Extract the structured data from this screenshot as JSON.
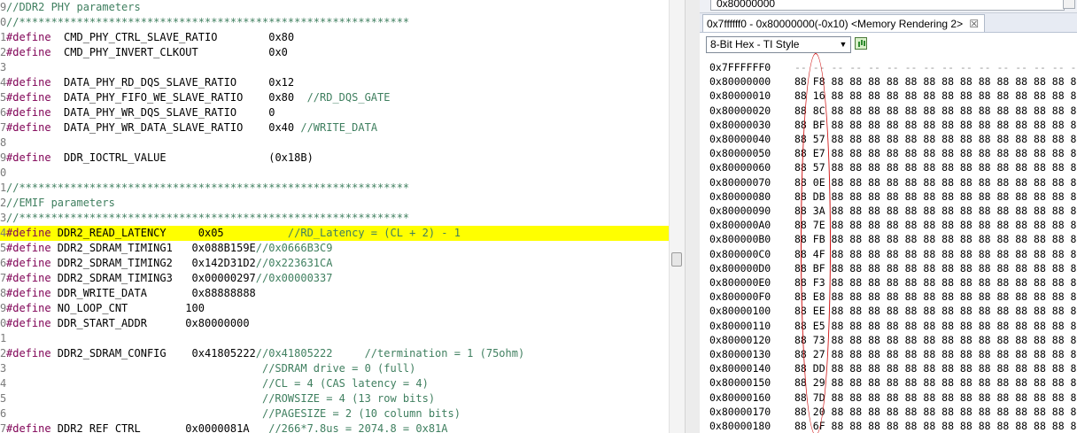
{
  "editor": {
    "line_number_digits": [
      "9",
      "0",
      "1",
      "2",
      "3",
      "4",
      "5",
      "6",
      "7",
      "8",
      "9",
      "0",
      "1",
      "2",
      "3",
      "4",
      "5",
      "6",
      "7",
      "8",
      "9",
      "0",
      "1",
      "2",
      "3",
      "4",
      "5",
      "6",
      "7"
    ],
    "lines": [
      {
        "parts": [
          {
            "t": "//DDR2 PHY parameters",
            "c": "cm"
          }
        ]
      },
      {
        "parts": [
          {
            "t": "//*************************************************************",
            "c": "cm"
          }
        ]
      },
      {
        "parts": [
          {
            "t": "#define",
            "c": "kw"
          },
          {
            "t": "  CMD_PHY_CTRL_SLAVE_RATIO        0x80",
            "c": "nm"
          }
        ]
      },
      {
        "parts": [
          {
            "t": "#define",
            "c": "kw"
          },
          {
            "t": "  CMD_PHY_INVERT_CLKOUT           0x0",
            "c": "nm"
          }
        ]
      },
      {
        "parts": []
      },
      {
        "parts": [
          {
            "t": "#define",
            "c": "kw"
          },
          {
            "t": "  DATA_PHY_RD_DQS_SLAVE_RATIO     0x12",
            "c": "nm"
          }
        ]
      },
      {
        "parts": [
          {
            "t": "#define",
            "c": "kw"
          },
          {
            "t": "  DATA_PHY_FIFO_WE_SLAVE_RATIO    0x80  ",
            "c": "nm"
          },
          {
            "t": "//RD_DQS_GATE",
            "c": "cm"
          }
        ]
      },
      {
        "parts": [
          {
            "t": "#define",
            "c": "kw"
          },
          {
            "t": "  DATA_PHY_WR_DQS_SLAVE_RATIO     0",
            "c": "nm"
          }
        ]
      },
      {
        "parts": [
          {
            "t": "#define",
            "c": "kw"
          },
          {
            "t": "  DATA_PHY_WR_DATA_SLAVE_RATIO    0x40 ",
            "c": "nm"
          },
          {
            "t": "//WRITE_DATA",
            "c": "cm"
          }
        ]
      },
      {
        "parts": []
      },
      {
        "parts": [
          {
            "t": "#define",
            "c": "kw"
          },
          {
            "t": "  DDR_IOCTRL_VALUE                (0x18B)",
            "c": "nm"
          }
        ]
      },
      {
        "parts": []
      },
      {
        "parts": [
          {
            "t": "//*************************************************************",
            "c": "cm"
          }
        ]
      },
      {
        "parts": [
          {
            "t": "//EMIF parameters",
            "c": "cm"
          }
        ]
      },
      {
        "parts": [
          {
            "t": "//*************************************************************",
            "c": "cm"
          }
        ]
      },
      {
        "hl": true,
        "parts": [
          {
            "t": "#define",
            "c": "kw"
          },
          {
            "t": " DDR2_READ_LATENCY     0x05          ",
            "c": "nm"
          },
          {
            "t": "//RD_Latency = (CL + 2) - 1",
            "c": "cm"
          }
        ]
      },
      {
        "parts": [
          {
            "t": "#define",
            "c": "kw"
          },
          {
            "t": " DDR2_SDRAM_TIMING1   0x088B159E",
            "c": "nm"
          },
          {
            "t": "//0x0666B3C9",
            "c": "cm"
          }
        ]
      },
      {
        "parts": [
          {
            "t": "#define",
            "c": "kw"
          },
          {
            "t": " DDR2_SDRAM_TIMING2   0x142D31D2",
            "c": "nm"
          },
          {
            "t": "//0x223631CA",
            "c": "cm"
          }
        ]
      },
      {
        "parts": [
          {
            "t": "#define",
            "c": "kw"
          },
          {
            "t": " DDR2_SDRAM_TIMING3   0x00000297",
            "c": "nm"
          },
          {
            "t": "//0x00000337",
            "c": "cm"
          }
        ]
      },
      {
        "parts": [
          {
            "t": "#define",
            "c": "kw"
          },
          {
            "t": " DDR_WRITE_DATA       0x88888888",
            "c": "nm"
          }
        ]
      },
      {
        "parts": [
          {
            "t": "#define",
            "c": "kw"
          },
          {
            "t": " NO_LOOP_CNT         100",
            "c": "nm"
          }
        ]
      },
      {
        "parts": [
          {
            "t": "#define",
            "c": "kw"
          },
          {
            "t": " DDR_START_ADDR      0x80000000",
            "c": "nm"
          }
        ]
      },
      {
        "parts": []
      },
      {
        "parts": [
          {
            "t": "#define",
            "c": "kw"
          },
          {
            "t": " DDR2_SDRAM_CONFIG    0x41805222",
            "c": "nm"
          },
          {
            "t": "//0x41805222     //termination = 1 (75ohm)",
            "c": "cm"
          }
        ]
      },
      {
        "parts": [
          {
            "t": "                                        //SDRAM drive = 0 (full)",
            "c": "cm"
          }
        ]
      },
      {
        "parts": [
          {
            "t": "                                        //CL = 4 (CAS latency = 4)",
            "c": "cm"
          }
        ]
      },
      {
        "parts": [
          {
            "t": "                                        //ROWSIZE = 4 (13 row bits)",
            "c": "cm"
          }
        ]
      },
      {
        "parts": [
          {
            "t": "                                        //PAGESIZE = 2 (10 column bits)",
            "c": "cm"
          }
        ]
      },
      {
        "parts": [
          {
            "t": "#define",
            "c": "kw"
          },
          {
            "t": " DDR2_REF_CTRL       0x0000081A   ",
            "c": "nm"
          },
          {
            "t": "//266*7.8us = 2074.8 = 0x81A",
            "c": "cm"
          }
        ]
      }
    ]
  },
  "memory": {
    "address_input": "0x80000000",
    "tab_label": "0x7ffffff0 - 0x80000000(-0x10) <Memory Rendering 2>",
    "tab_close": "☒",
    "format": "8-Bit Hex - TI Style",
    "format_arrow": "▼",
    "rows": [
      {
        "addr": "0x7FFFFFF0",
        "bytes": "-- -- -- -- -- -- -- -- -- -- -- -- -- -- -- --",
        "pre": true
      },
      {
        "addr": "0x80000000",
        "bytes": "88 F8 88 88 88 88 88 88 88 88 88 88 88 88 88 88"
      },
      {
        "addr": "0x80000010",
        "bytes": "88 16 88 88 88 88 88 88 88 88 88 88 88 88 88 88"
      },
      {
        "addr": "0x80000020",
        "bytes": "88 8C 88 88 88 88 88 88 88 88 88 88 88 88 88 88"
      },
      {
        "addr": "0x80000030",
        "bytes": "88 BF 88 88 88 88 88 88 88 88 88 88 88 88 88 88"
      },
      {
        "addr": "0x80000040",
        "bytes": "88 57 88 88 88 88 88 88 88 88 88 88 88 88 88 88"
      },
      {
        "addr": "0x80000050",
        "bytes": "88 E7 88 88 88 88 88 88 88 88 88 88 88 88 88 88"
      },
      {
        "addr": "0x80000060",
        "bytes": "88 57 88 88 88 88 88 88 88 88 88 88 88 88 88 88"
      },
      {
        "addr": "0x80000070",
        "bytes": "88 0E 88 88 88 88 88 88 88 88 88 88 88 88 88 88"
      },
      {
        "addr": "0x80000080",
        "bytes": "88 DB 88 88 88 88 88 88 88 88 88 88 88 88 88 88"
      },
      {
        "addr": "0x80000090",
        "bytes": "88 3A 88 88 88 88 88 88 88 88 88 88 88 88 88 88"
      },
      {
        "addr": "0x800000A0",
        "bytes": "88 7E 88 88 88 88 88 88 88 88 88 88 88 88 88 88"
      },
      {
        "addr": "0x800000B0",
        "bytes": "88 FB 88 88 88 88 88 88 88 88 88 88 88 88 88 88"
      },
      {
        "addr": "0x800000C0",
        "bytes": "88 4F 88 88 88 88 88 88 88 88 88 88 88 88 88 88"
      },
      {
        "addr": "0x800000D0",
        "bytes": "88 BF 88 88 88 88 88 88 88 88 88 88 88 88 88 88"
      },
      {
        "addr": "0x800000E0",
        "bytes": "88 F3 88 88 88 88 88 88 88 88 88 88 88 88 88 88"
      },
      {
        "addr": "0x800000F0",
        "bytes": "88 E8 88 88 88 88 88 88 88 88 88 88 88 88 88 88"
      },
      {
        "addr": "0x80000100",
        "bytes": "88 EE 88 88 88 88 88 88 88 88 88 88 88 88 88 88"
      },
      {
        "addr": "0x80000110",
        "bytes": "88 E5 88 88 88 88 88 88 88 88 88 88 88 88 88 88"
      },
      {
        "addr": "0x80000120",
        "bytes": "88 73 88 88 88 88 88 88 88 88 88 88 88 88 88 88"
      },
      {
        "addr": "0x80000130",
        "bytes": "88 27 88 88 88 88 88 88 88 88 88 88 88 88 88 88"
      },
      {
        "addr": "0x80000140",
        "bytes": "88 DD 88 88 88 88 88 88 88 88 88 88 88 88 88 88"
      },
      {
        "addr": "0x80000150",
        "bytes": "88 29 88 88 88 88 88 88 88 88 88 88 88 88 88 88"
      },
      {
        "addr": "0x80000160",
        "bytes": "88 7D 88 88 88 88 88 88 88 88 88 88 88 88 88 88"
      },
      {
        "addr": "0x80000170",
        "bytes": "88 20 88 88 88 88 88 88 88 88 88 88 88 88 88 88"
      },
      {
        "addr": "0x80000180",
        "bytes": "88 6F 88 88 88 88 88 88 88 88 88 88 88 88 88 88"
      }
    ]
  },
  "colors": {
    "highlight": "#ffff00",
    "keyword": "#7f0055",
    "comment": "#3f7f5f",
    "annotation": "#d01414"
  }
}
